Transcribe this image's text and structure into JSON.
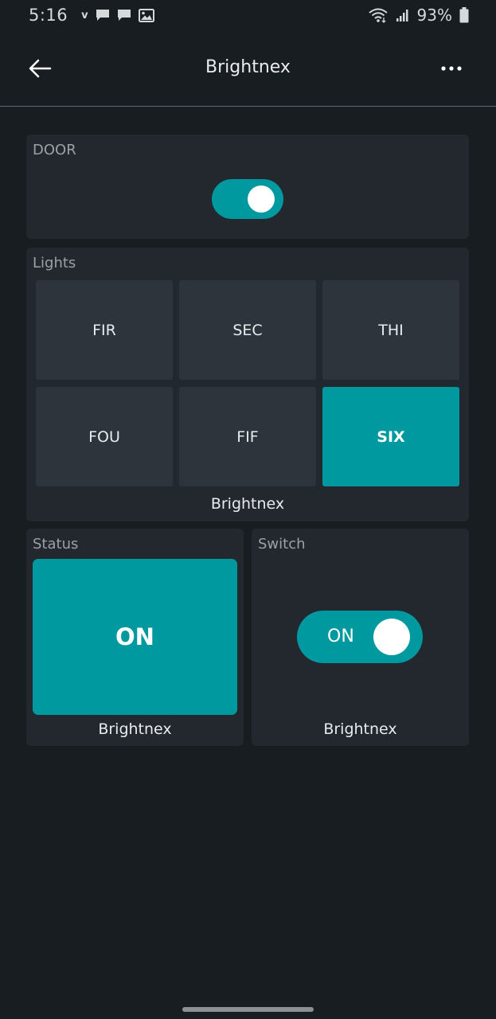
{
  "status_bar": {
    "time": "5:16",
    "carrier_mark": "v",
    "battery": "93%",
    "icons": [
      "message-icon",
      "message-icon",
      "image-icon",
      "wifi-icon",
      "signal-icon",
      "battery-icon"
    ]
  },
  "app_bar": {
    "title": "Brightnex",
    "back_icon": "arrow-left-icon",
    "menu_icon": "more-horizontal-icon"
  },
  "door": {
    "label": "DOOR",
    "on": true
  },
  "lights": {
    "label": "Lights",
    "buttons": [
      {
        "label": "FIR",
        "active": false
      },
      {
        "label": "SEC",
        "active": false
      },
      {
        "label": "THI",
        "active": false
      },
      {
        "label": "FOU",
        "active": false
      },
      {
        "label": "FIF",
        "active": false
      },
      {
        "label": "SIX",
        "active": true
      }
    ],
    "caption": "Brightnex"
  },
  "status": {
    "label": "Status",
    "value": "ON",
    "caption": "Brightnex"
  },
  "switch": {
    "label": "Switch",
    "value": "ON",
    "caption": "Brightnex"
  },
  "colors": {
    "accent": "#00999f",
    "background": "#181d22",
    "card": "#22282e",
    "tile": "#2d343c"
  }
}
